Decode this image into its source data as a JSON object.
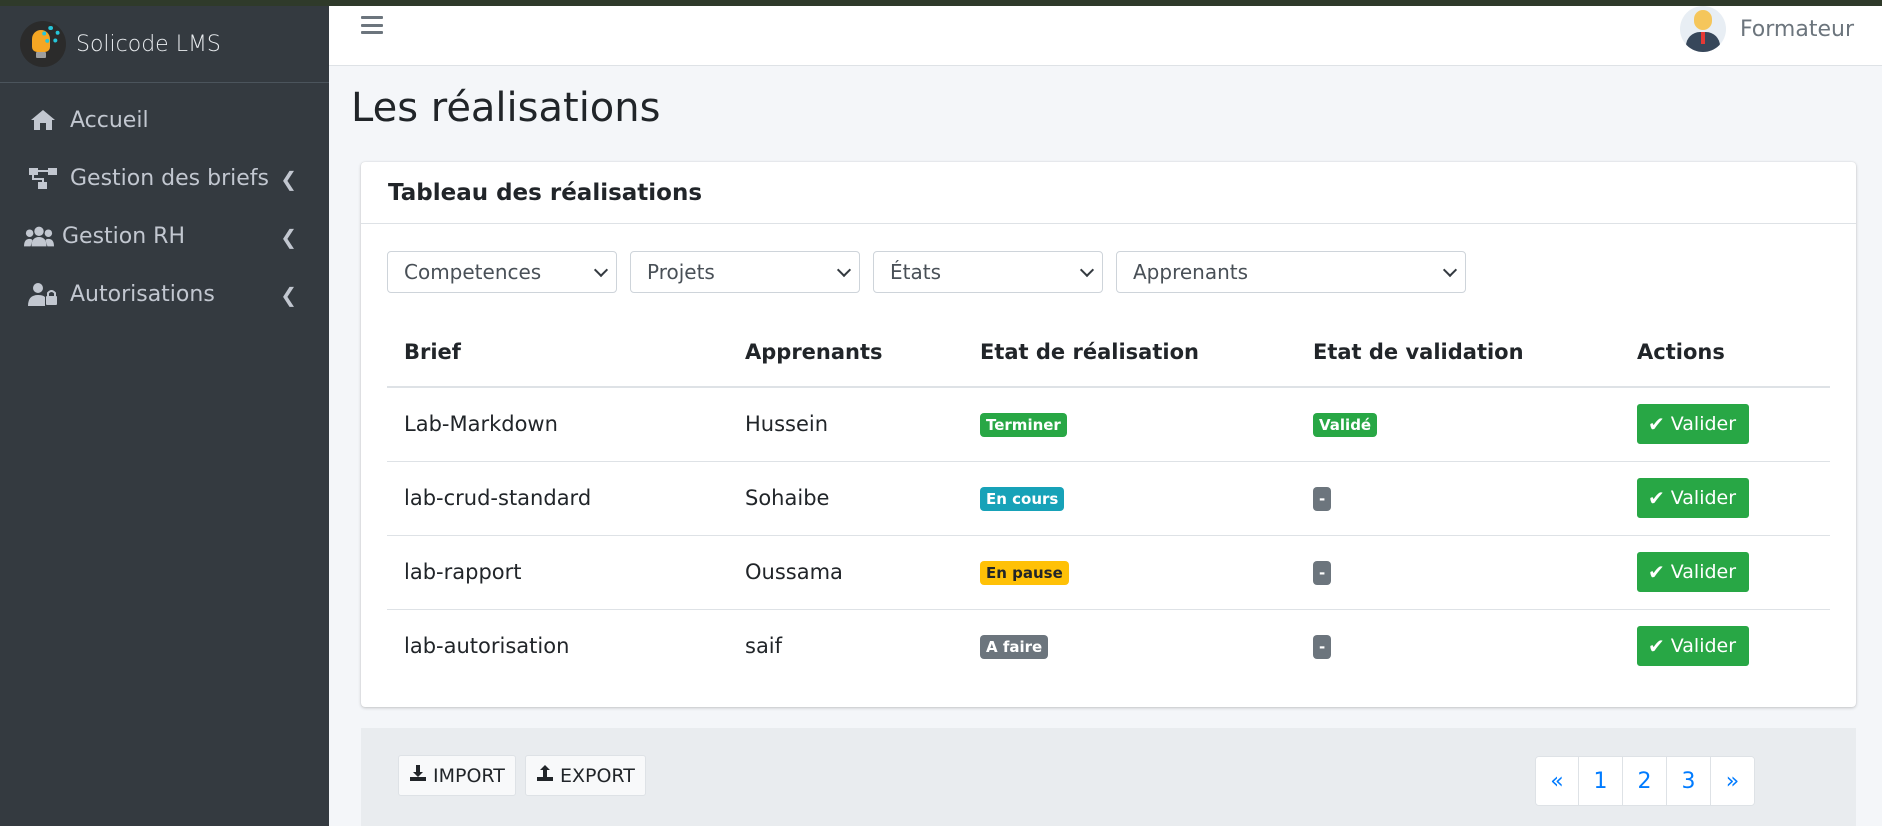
{
  "app": {
    "brand": "Solicode LMS"
  },
  "sidebar": {
    "items": [
      {
        "label": "Accueil",
        "icon": "home-icon",
        "expandable": false
      },
      {
        "label": "Gestion des briefs",
        "icon": "sitemap-icon",
        "expandable": true
      },
      {
        "label": "Gestion RH",
        "icon": "users-icon",
        "expandable": true
      },
      {
        "label": "Autorisations",
        "icon": "user-lock-icon",
        "expandable": true
      }
    ]
  },
  "header": {
    "user": "Formateur"
  },
  "page": {
    "title": "Les réalisations"
  },
  "card": {
    "title": "Tableau des réalisations"
  },
  "filters": [
    {
      "value": "Competences"
    },
    {
      "value": "Projets"
    },
    {
      "value": "États"
    },
    {
      "value": "Apprenants"
    }
  ],
  "table": {
    "columns": [
      "Brief",
      "Apprenants",
      "Etat de réalisation",
      "Etat de validation",
      "Actions"
    ],
    "rows": [
      {
        "brief": "Lab-Markdown",
        "apprenant": "Hussein",
        "etat": "Terminer",
        "etat_color": "#28a745",
        "validation": "Validé",
        "validation_color": "#28a745",
        "action": "Valider"
      },
      {
        "brief": "lab-crud-standard",
        "apprenant": "Sohaibe",
        "etat": "En cours",
        "etat_color": "#17a2b8",
        "validation": "-",
        "validation_color": "#6c757d",
        "action": "Valider"
      },
      {
        "brief": "lab-rapport",
        "apprenant": "Oussama",
        "etat": "En pause",
        "etat_color": "#ffc107",
        "validation": "-",
        "validation_color": "#6c757d",
        "action": "Valider"
      },
      {
        "brief": "lab-autorisation",
        "apprenant": "saif",
        "etat": "A faire",
        "etat_color": "#6c757d",
        "validation": "-",
        "validation_color": "#6c757d",
        "action": "Valider"
      }
    ]
  },
  "footer": {
    "import_label": "IMPORT",
    "export_label": "EXPORT",
    "pagination": [
      "«",
      "1",
      "2",
      "3",
      "»"
    ]
  },
  "colors": {
    "sidebar_bg": "#343a40",
    "success": "#28a745",
    "info": "#17a2b8",
    "warning": "#ffc107",
    "secondary": "#6c757d",
    "link": "#007bff"
  }
}
